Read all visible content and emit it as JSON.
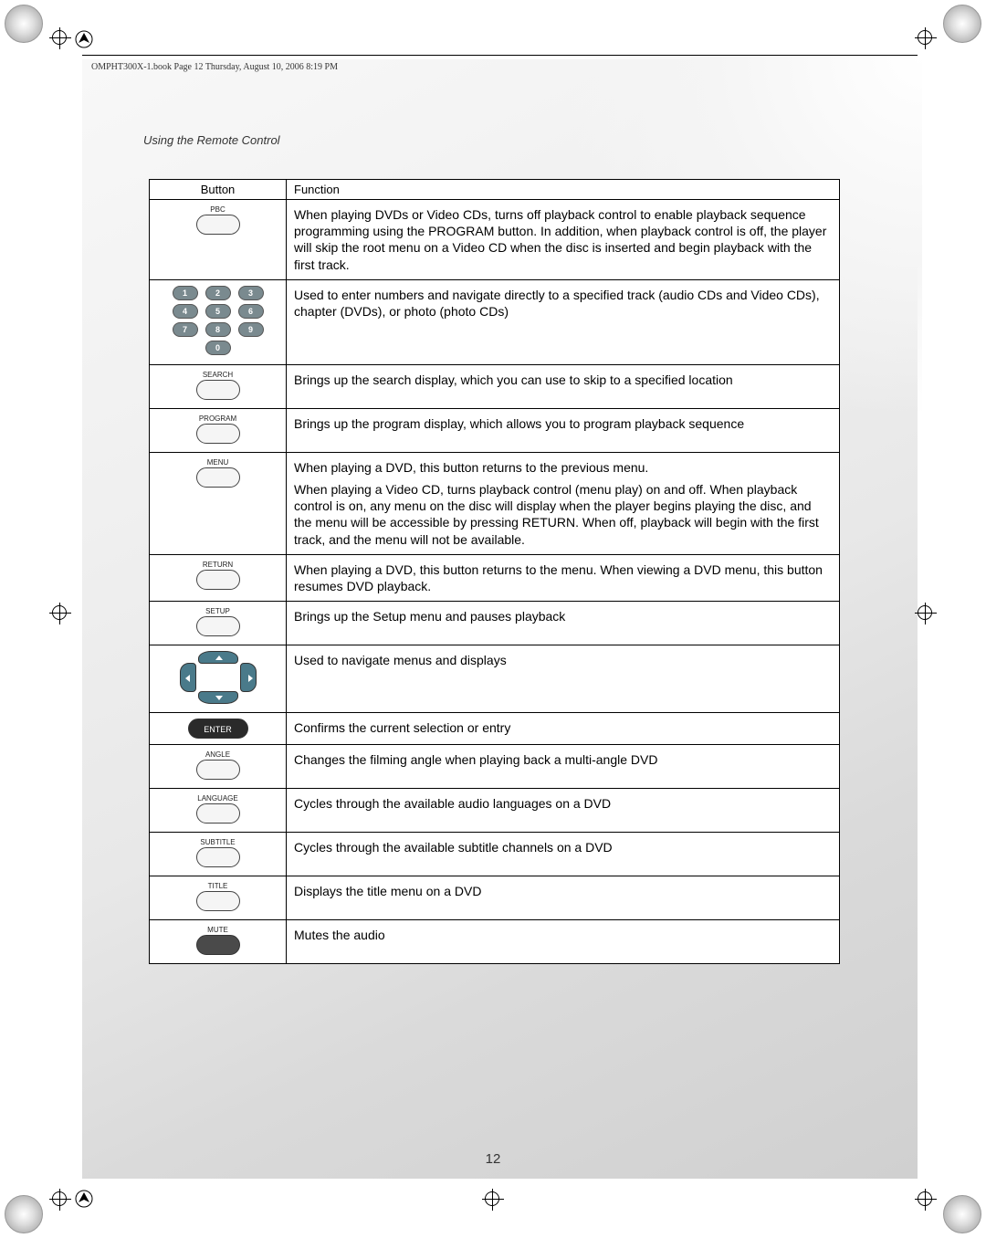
{
  "header_line": "OMPHT300X-1.book  Page 12  Thursday, August 10, 2006  8:19 PM",
  "section_title": "Using the Remote Control",
  "page_number": "12",
  "table": {
    "col_button": "Button",
    "col_function": "Function",
    "rows": [
      {
        "button_label": "PBC",
        "function": "When playing DVDs or Video CDs, turns off playback control to enable playback sequence programming using the PROGRAM button. In addition, when playback control is off, the player will skip the root menu on a Video CD when the disc is inserted and begin playback with the first track."
      },
      {
        "button_label": "",
        "function": "Used to enter numbers and navigate directly to a specified track (audio CDs and Video CDs), chapter (DVDs), or photo (photo CDs)"
      },
      {
        "button_label": "SEARCH",
        "function": "Brings up the search display, which you can use to skip to a specified location"
      },
      {
        "button_label": "PROGRAM",
        "function": "Brings up the program display, which allows you to program playback sequence"
      },
      {
        "button_label": "MENU",
        "function_p1": "When playing a DVD, this button returns to the previous menu.",
        "function_p2": "When playing a Video CD, turns playback control (menu play) on and off. When playback control is on, any menu on the disc will display when the player begins playing the disc, and the menu will be accessible by pressing RETURN. When off, playback will begin with the first track, and the menu will not be available."
      },
      {
        "button_label": "RETURN",
        "function": "When playing a DVD, this button returns to the menu. When viewing a DVD menu, this button resumes DVD playback."
      },
      {
        "button_label": "SETUP",
        "function": "Brings up the Setup menu and pauses playback"
      },
      {
        "button_label": "",
        "function": "Used to navigate menus and displays"
      },
      {
        "button_label": "ENTER",
        "function": "Confirms the current selection or entry"
      },
      {
        "button_label": "ANGLE",
        "function": "Changes the filming angle when playing back a multi-angle DVD"
      },
      {
        "button_label": "LANGUAGE",
        "function": "Cycles through the available audio languages on a DVD"
      },
      {
        "button_label": "SUBTITLE",
        "function": "Cycles through the available subtitle channels on a DVD"
      },
      {
        "button_label": "TITLE",
        "function": "Displays the title menu on a DVD"
      },
      {
        "button_label": "MUTE",
        "function": "Mutes the audio"
      }
    ]
  },
  "numpad": [
    "1",
    "2",
    "3",
    "4",
    "5",
    "6",
    "7",
    "8",
    "9",
    "0"
  ]
}
